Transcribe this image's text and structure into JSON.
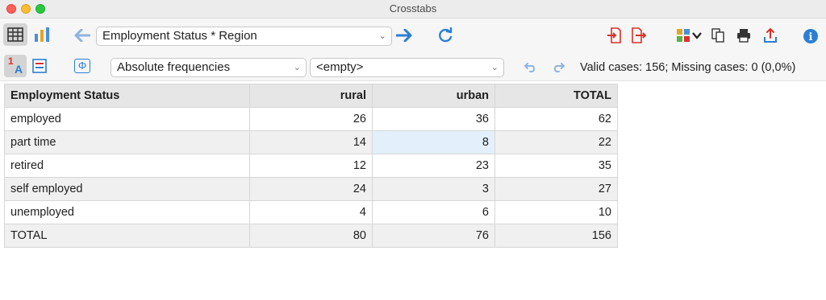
{
  "window": {
    "title": "Crosstabs"
  },
  "toolbar": {
    "variable_selector": "Employment Status * Region",
    "frequency_selector": "Absolute frequencies",
    "filter_selector": "<empty>",
    "status_text": "Valid cases: 156;  Missing cases: 0 (0,0%)",
    "info_glyph": "i",
    "formula_glyph": "Φ",
    "sort_glyph_1": "1",
    "sort_glyph_a": "A"
  },
  "icons": [
    "table-view-icon",
    "chart-view-icon",
    "back-arrow-icon",
    "forward-arrow-icon",
    "refresh-icon",
    "import-icon",
    "export-icon",
    "color-palette-icon",
    "copy-icon",
    "print-icon",
    "share-icon",
    "info-icon",
    "sort-icon",
    "layout-icon",
    "formula-icon",
    "undo-icon",
    "redo-icon"
  ],
  "table": {
    "headers": [
      "Employment Status",
      "rural",
      "urban",
      "TOTAL"
    ],
    "rows": [
      [
        "employed",
        "26",
        "36",
        "62"
      ],
      [
        "part time",
        "14",
        "8",
        "22"
      ],
      [
        "retired",
        "12",
        "23",
        "35"
      ],
      [
        "self employed",
        "24",
        "3",
        "27"
      ],
      [
        "unemployed",
        "4",
        "6",
        "10"
      ],
      [
        "TOTAL",
        "80",
        "76",
        "156"
      ]
    ]
  },
  "colors": {
    "accent_blue": "#2a7fd4",
    "red": "#d9302a",
    "selected_cell": "#e3f0fb"
  }
}
